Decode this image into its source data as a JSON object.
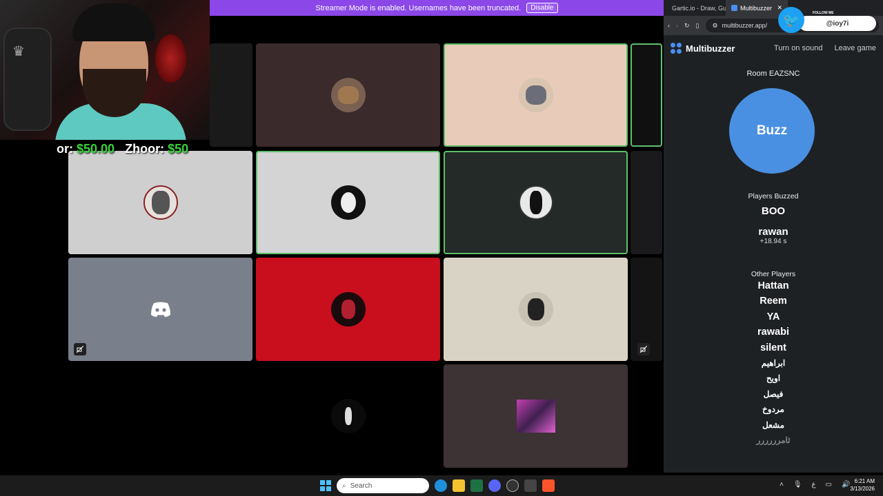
{
  "streamer_bar": {
    "message": "Streamer Mode is enabled. Usernames have been truncated.",
    "button": "Disable"
  },
  "ticker": {
    "a_name": "or:",
    "a_money": "$50.00",
    "b_name": "Zhoor:",
    "b_money": "$50"
  },
  "browser": {
    "tabs": [
      {
        "label": "Gartic.io - Draw, Gu..."
      },
      {
        "label": "Multibuzzer"
      }
    ],
    "url": "multibuzzer.app/"
  },
  "twitter": {
    "follow": "FOLLOW ME",
    "handle": "@ioy7i"
  },
  "app": {
    "brand": "Multibuzzer",
    "turn_on_sound": "Turn on sound",
    "leave_game": "Leave game",
    "room": "Room EAZSNC",
    "buzz_label": "Buzz",
    "players_buzzed_title": "Players Buzzed",
    "buzzed": [
      {
        "name": "BOO",
        "time": ""
      },
      {
        "name": "rawan",
        "time": "+18.94 s"
      }
    ],
    "other_players_title": "Other Players",
    "other_players": [
      "Hattan",
      "Reem",
      "YA",
      "rawabi",
      "silent",
      "ابراهيم",
      "اويح",
      "فيصل",
      "مردوخ",
      "مشعل",
      "ثامرررررر"
    ]
  },
  "taskbar": {
    "search": "Search",
    "time": "6:21 AM",
    "date": "3/13/2026"
  }
}
